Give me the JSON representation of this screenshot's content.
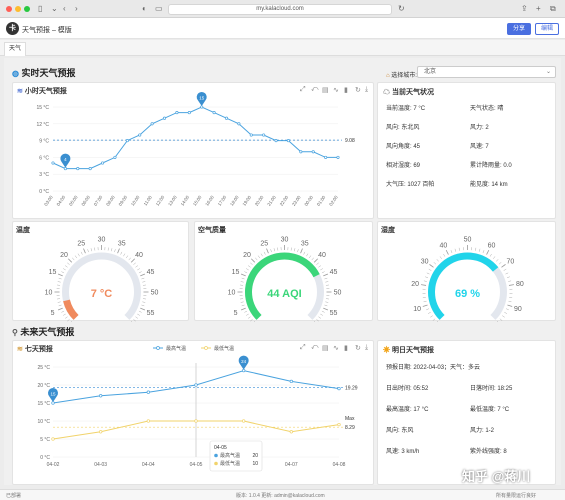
{
  "browser": {
    "url": "my.kalacloud.com"
  },
  "app": {
    "logo_text": "卡",
    "title": "天气预报 – 模版",
    "share_label": "分享",
    "edit_label": "编辑"
  },
  "tabs": [
    {
      "label": "天气"
    }
  ],
  "realtime": {
    "section_title": "实时天气预报",
    "city_label": "选择城市:",
    "city_value": "北京"
  },
  "hourly_chart": {
    "title": "小时天气预报",
    "chart_data": {
      "type": "line",
      "x": [
        "03:00",
        "04:00",
        "05:00",
        "06:00",
        "07:00",
        "08:00",
        "09:00",
        "10:00",
        "11:00",
        "12:00",
        "13:00",
        "14:00",
        "15:00",
        "16:00",
        "17:00",
        "18:00",
        "19:00",
        "20:00",
        "21:00",
        "22:00",
        "23:00",
        "00:00",
        "01:00",
        "02:00"
      ],
      "series": [
        {
          "values": [
            5,
            4,
            4,
            4,
            5,
            6,
            9,
            10,
            12,
            13,
            14,
            14,
            15,
            14,
            13,
            12,
            10,
            10,
            9,
            9,
            7,
            7,
            6,
            6
          ]
        }
      ],
      "ylim": [
        0,
        15
      ],
      "yticks": [
        "0 °C",
        "3 °C",
        "6 °C",
        "9 °C",
        "12 °C",
        "15 °C"
      ],
      "markpoints": {
        "max": "15",
        "min": "4"
      },
      "markline": "9.08"
    }
  },
  "current": {
    "title": "当前天气状况",
    "rows": [
      [
        {
          "label": "当前温度:",
          "value": "7 °C"
        },
        {
          "label": "天气状态:",
          "value": "晴"
        }
      ],
      [
        {
          "label": "风向:",
          "value": "东北风"
        },
        {
          "label": "风力:",
          "value": "2"
        }
      ],
      [
        {
          "label": "风向角度:",
          "value": "45"
        },
        {
          "label": "风速:",
          "value": "7"
        }
      ],
      [
        {
          "label": "相对湿度:",
          "value": "69"
        },
        {
          "label": "累计降雨量:",
          "value": "0.0"
        }
      ],
      [
        {
          "label": "大气压:",
          "value": "1027 百帕"
        },
        {
          "label": "能见度:",
          "value": "14 km"
        }
      ]
    ]
  },
  "gauges": [
    {
      "title": "温度",
      "value": 7,
      "display": "7 °C",
      "min": 0,
      "max": 60,
      "ticks": [
        "0",
        "5",
        "10",
        "15",
        "20",
        "25",
        "30",
        "35",
        "40",
        "45",
        "50",
        "55",
        "60"
      ],
      "color": "#f08a5d"
    },
    {
      "title": "空气质量",
      "value": 44,
      "display": "44 AQI",
      "min": 0,
      "max": 60,
      "ticks": [
        "0",
        "5",
        "10",
        "15",
        "20",
        "25",
        "30",
        "35",
        "40",
        "45",
        "50",
        "55",
        "60"
      ],
      "color": "#3bd67a"
    },
    {
      "title": "湿度",
      "value": 69,
      "display": "69 %",
      "min": 0,
      "max": 100,
      "ticks": [
        "0",
        "10",
        "20",
        "30",
        "40",
        "50",
        "60",
        "70",
        "80",
        "90",
        "100"
      ],
      "color": "#21d4ea"
    }
  ],
  "future": {
    "section_title": "未来天气预报",
    "chart_title": "七天预报",
    "legend": [
      "最高气温",
      "最低气温"
    ],
    "chart_data": {
      "type": "line",
      "x": [
        "04-02",
        "04-03",
        "04-04",
        "04-05",
        "04-06",
        "04-07",
        "04-08"
      ],
      "series": [
        {
          "name": "最高气温",
          "values": [
            15,
            17,
            18,
            20,
            24,
            21,
            19
          ]
        },
        {
          "name": "最低气温",
          "values": [
            5,
            7,
            10,
            10,
            10,
            7,
            9
          ]
        }
      ],
      "ylim": [
        0,
        25
      ],
      "yticks": [
        "0 °C",
        "5 °C",
        "10 °C",
        "15 °C",
        "20 °C",
        "25 °C"
      ],
      "max_label": "Max",
      "markline_high": "19.29",
      "markline_low": "8.29",
      "markpoint_high": "24",
      "markpoint_low": "15",
      "tooltip": {
        "date": "04-05",
        "rows": [
          {
            "name": "最高气温",
            "value": "20"
          },
          {
            "name": "最低气温",
            "value": "10"
          }
        ]
      }
    }
  },
  "tomorrow": {
    "title": "明日天气预报",
    "rows": [
      [
        {
          "label": "预报日期:",
          "value": "2022-04-03；天气：多云"
        }
      ],
      [
        {
          "label": "日出时间:",
          "value": "05:52"
        },
        {
          "label": "日落时间:",
          "value": "18:25"
        }
      ],
      [
        {
          "label": "最高温度:",
          "value": "17 °C"
        },
        {
          "label": "最低温度:",
          "value": "7 °C"
        }
      ],
      [
        {
          "label": "风向:",
          "value": "东风"
        },
        {
          "label": "风力:",
          "value": "1-2"
        }
      ],
      [
        {
          "label": "风速:",
          "value": "3 km/h"
        },
        {
          "label": "紫外线强度:",
          "value": "8"
        }
      ]
    ]
  },
  "footer": {
    "left": "已部署",
    "center": "版本: 1.0.4 更新: admin@kalacloud.com",
    "right": "所有量限运行良好"
  },
  "watermark": "知乎 @蒋川"
}
